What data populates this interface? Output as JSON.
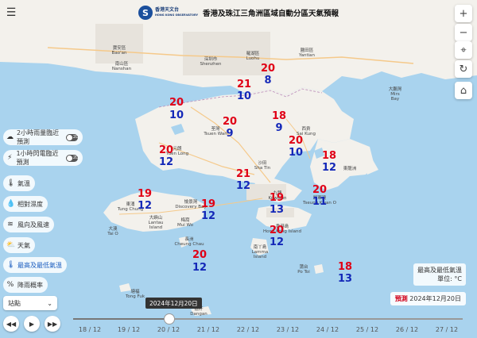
{
  "header": {
    "logo_cn": "香港天文台",
    "logo_en": "HONG KONG OBSERVATORY",
    "title": "香港及珠江三角洲區域自動分區天氣預報"
  },
  "sidebar": {
    "items": [
      {
        "icon": "rain-cloud-icon",
        "label": "2小時雨量臨近預測",
        "toggle": "2D"
      },
      {
        "icon": "lightning-icon",
        "label": "1小時閃電臨近預測",
        "toggle": "2D"
      },
      {
        "icon": "thermometer-icon",
        "label": "氣溫"
      },
      {
        "icon": "droplet-icon",
        "label": "相對濕度"
      },
      {
        "icon": "wind-icon",
        "label": "風向及風速"
      },
      {
        "icon": "weather-icon",
        "label": "天氣"
      },
      {
        "icon": "temp-range-icon",
        "label": "最高及最低氣溫"
      },
      {
        "icon": "percent-icon",
        "label": "降雨概率"
      }
    ],
    "station_select": "站點"
  },
  "legend": {
    "title": "最高及最低氣溫",
    "unit": "單位: °C"
  },
  "forecast": {
    "label": "預測",
    "date": "2024年12月20日"
  },
  "timeline": {
    "tooltip": "2024年12月20日",
    "current": "20 / 12",
    "dates": [
      "18 / 12",
      "19 / 12",
      "20 / 12",
      "21 / 12",
      "22 / 12",
      "23 / 12",
      "24 / 12",
      "25 / 12",
      "26 / 12",
      "27 / 12"
    ]
  },
  "temperatures": [
    {
      "max": "20",
      "min": "8"
    },
    {
      "max": "21",
      "min": "10"
    },
    {
      "max": "20",
      "min": "10"
    },
    {
      "max": "20",
      "min": "9"
    },
    {
      "max": "18",
      "min": "9"
    },
    {
      "max": "20",
      "min": "10"
    },
    {
      "max": "20",
      "min": "12"
    },
    {
      "max": "18",
      "min": "12"
    },
    {
      "max": "21",
      "min": "12"
    },
    {
      "max": "19",
      "min": "12"
    },
    {
      "max": "19",
      "min": "12"
    },
    {
      "max": "19",
      "min": "13"
    },
    {
      "max": "20",
      "min": "11"
    },
    {
      "max": "20",
      "min": "12"
    },
    {
      "max": "20",
      "min": "12"
    },
    {
      "max": "18",
      "min": "13"
    }
  ],
  "places": [
    {
      "name": "寶安區\nBao'an"
    },
    {
      "name": "南山區\nNanshan"
    },
    {
      "name": "深圳市\nShenzhen"
    },
    {
      "name": "羅湖區\nLuohu"
    },
    {
      "name": "鹽田區\nYantian"
    },
    {
      "name": "大鵬灣\nMirs\nBay"
    },
    {
      "name": "荃灣\nTsuen Wan"
    },
    {
      "name": "沙田\nSha Tin"
    },
    {
      "name": "西貢\nSai Kung"
    },
    {
      "name": "九龍\nKowloon"
    },
    {
      "name": "香港島\nHong Kong Island"
    },
    {
      "name": "大嶼山\nLantau\nIsland"
    },
    {
      "name": "東涌\nTung Chung"
    },
    {
      "name": "愉景灣\nDiscovery Bay"
    },
    {
      "name": "梅窩\nMui Wo"
    },
    {
      "name": "大澳\nTai O"
    },
    {
      "name": "南丫島\nLamma\nIsland"
    },
    {
      "name": "將軍澳\nTseung Kwan O"
    },
    {
      "name": "元朗\nYuen Long"
    },
    {
      "name": "蒲台\nPo Toi"
    },
    {
      "name": "長洲\nCheung Chau"
    },
    {
      "name": "東龍洲"
    },
    {
      "name": "擔杆\nDangan"
    },
    {
      "name": "塘福\nTong Fuk"
    }
  ],
  "colors": {
    "max": "#e00016",
    "min": "#1428b8",
    "sea": "#a9d3ee",
    "land": "#f3f1ec",
    "accent": "#1a5dbf"
  }
}
